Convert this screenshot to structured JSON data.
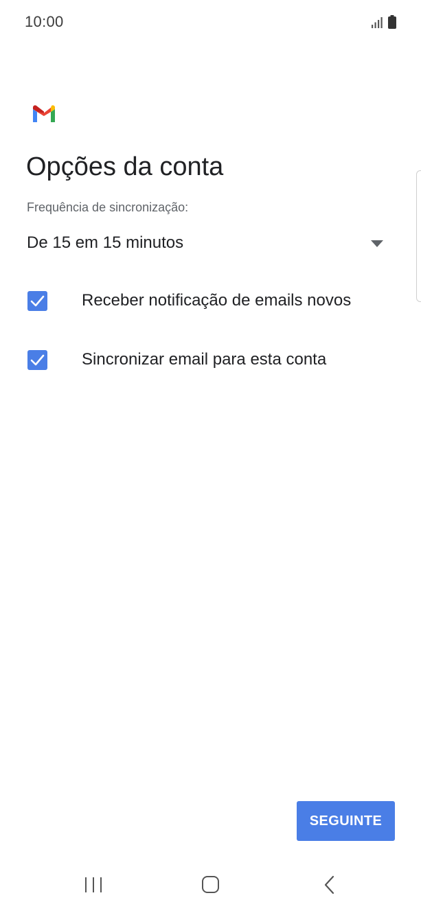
{
  "status_bar": {
    "time": "10:00",
    "icons": [
      "signal-icon",
      "battery-icon"
    ]
  },
  "app": {
    "logo": "gmail-logo"
  },
  "page": {
    "title": "Opções da conta"
  },
  "sync_frequency": {
    "label": "Frequência de sincronização:",
    "selected": "De 15 em 15 minutos"
  },
  "options": [
    {
      "label": "Receber notificação de emails novos",
      "checked": true
    },
    {
      "label": "Sincronizar email para esta conta",
      "checked": true
    }
  ],
  "actions": {
    "next_label": "SEGUINTE"
  },
  "nav_bar": {
    "items": [
      "recents-icon",
      "home-icon",
      "back-icon"
    ]
  },
  "colors": {
    "accent": "#4a7ee6",
    "text_primary": "#202124",
    "text_secondary": "#5f6368"
  }
}
